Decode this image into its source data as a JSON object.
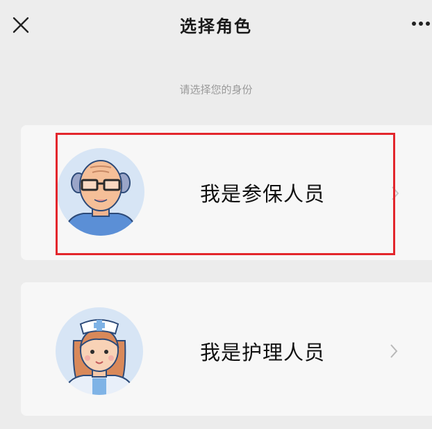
{
  "header": {
    "title": "选择角色",
    "close_icon": "close-icon",
    "more_icon": "more-icon"
  },
  "subtitle": "请选择您的身份",
  "roles": [
    {
      "label": "我是参保人员",
      "icon": "elderly-man-avatar-icon",
      "highlighted": true,
      "highlight_color": "#e3262c"
    },
    {
      "label": "我是护理人员",
      "icon": "nurse-avatar-icon",
      "highlighted": false
    }
  ],
  "colors": {
    "background": "#ececec",
    "card": "#f7f7f7",
    "highlight": "#e3262c",
    "avatar_bg": "#d7e5f5"
  }
}
